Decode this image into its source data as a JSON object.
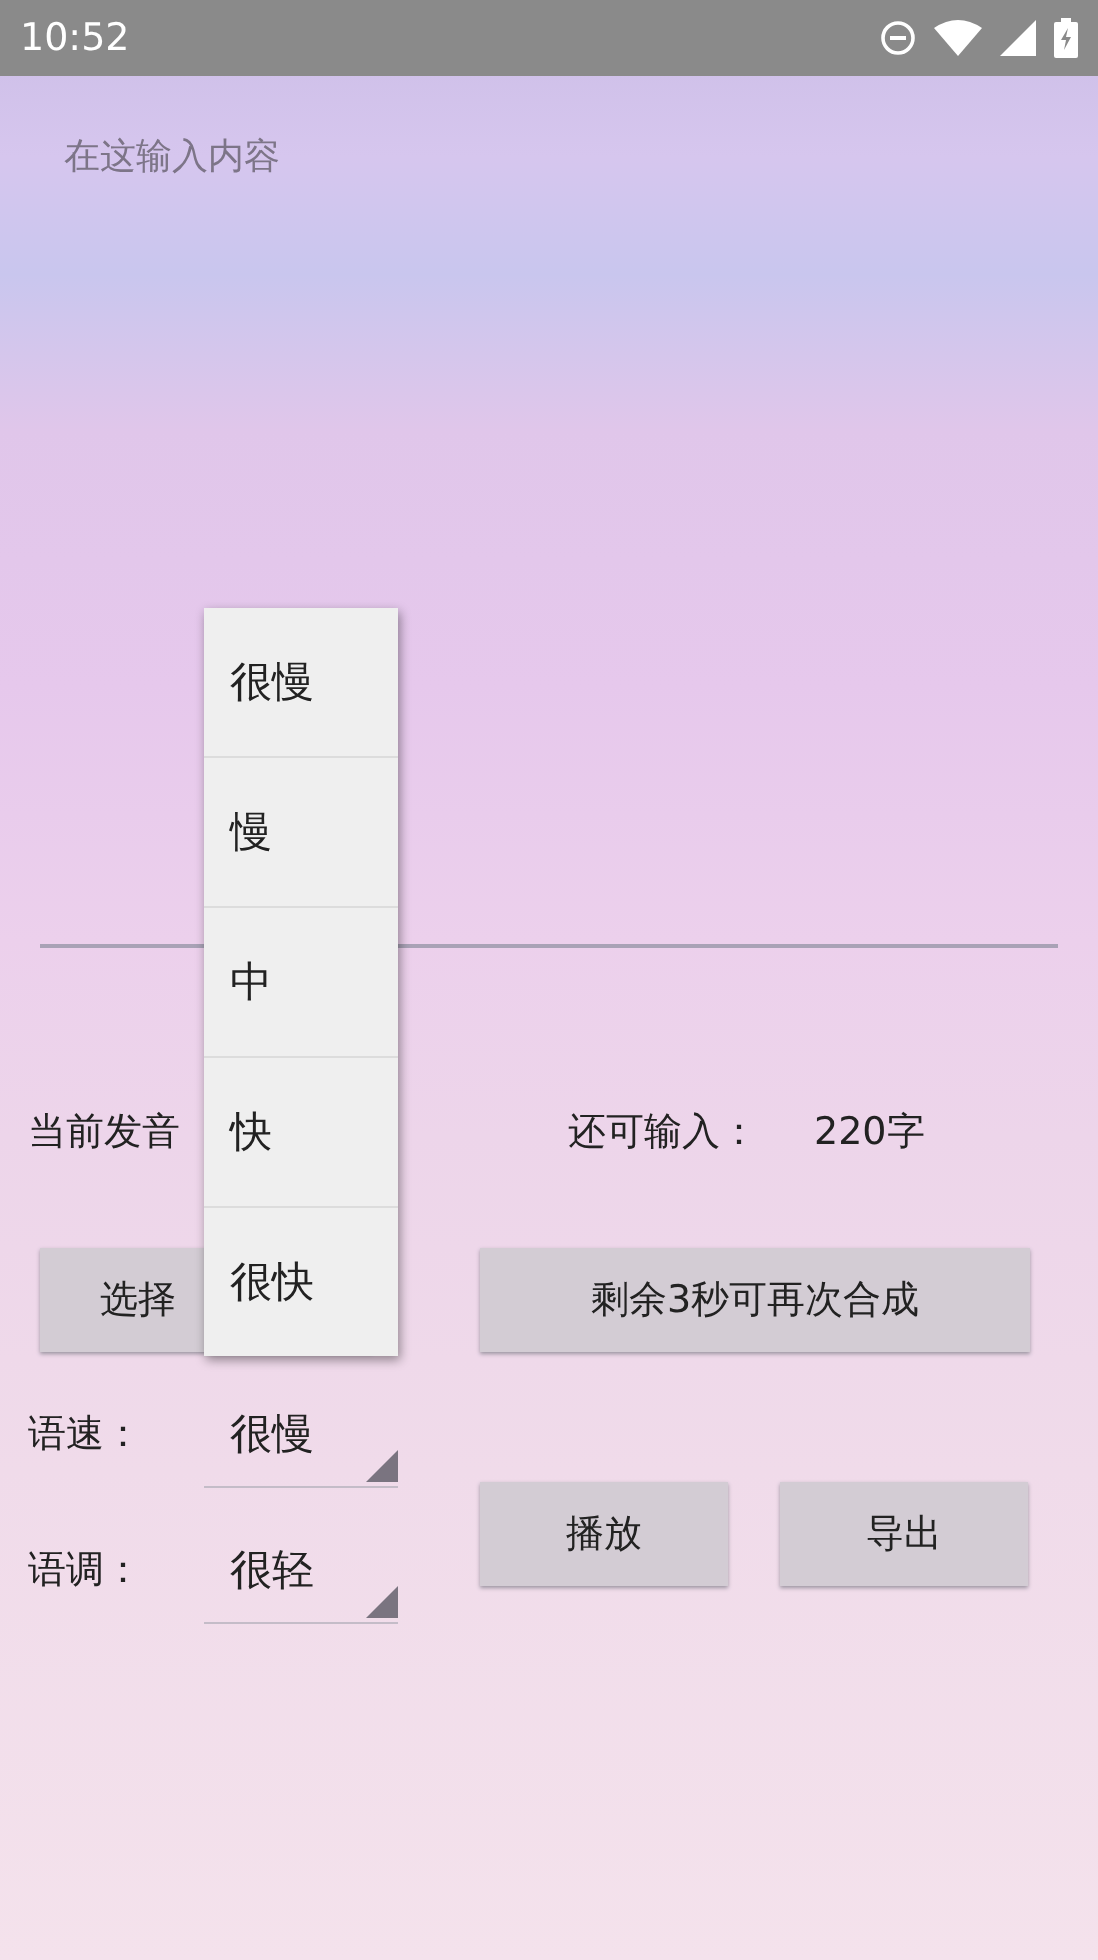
{
  "status_bar": {
    "time": "10:52"
  },
  "text_input": {
    "placeholder": "在这输入内容"
  },
  "voice_label": "当前发音",
  "remaining_label": "还可输入：",
  "remaining_count": "220字",
  "choose_voice_button": "选择",
  "synthesize_button": "剩余3秒可再次合成",
  "speed": {
    "label": "语速：",
    "value": "很慢"
  },
  "tone": {
    "label": "语调：",
    "value": "很轻"
  },
  "play_button": "播放",
  "export_button": "导出",
  "dropdown": {
    "options": [
      "很慢",
      "慢",
      "中",
      "快",
      "很快"
    ]
  }
}
